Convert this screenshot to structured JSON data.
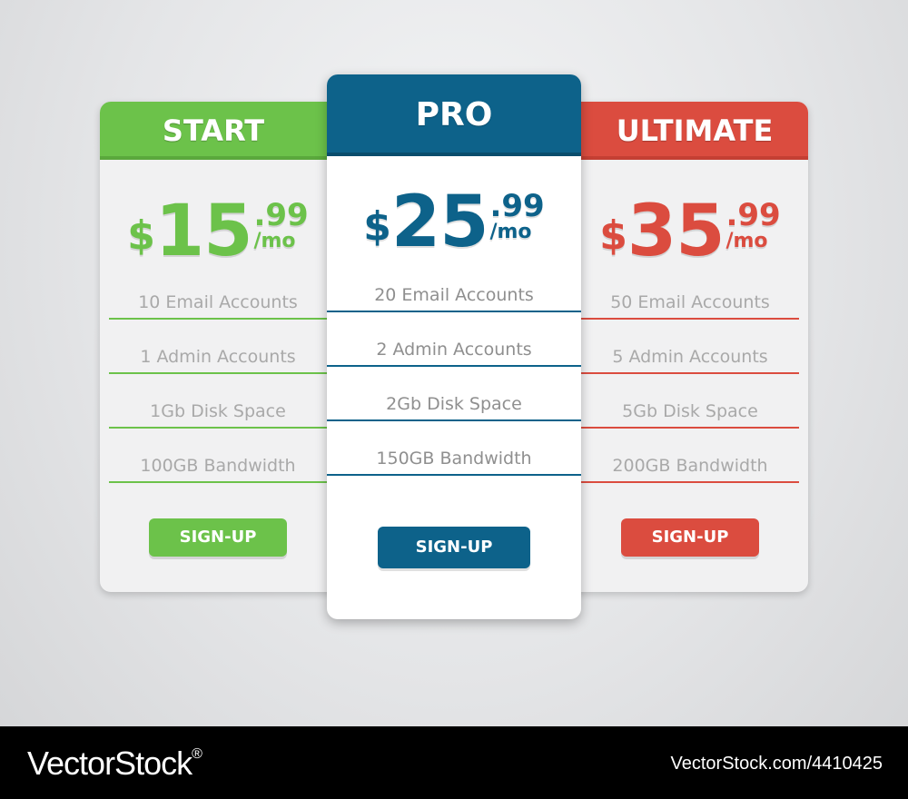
{
  "plans": [
    {
      "name": "START",
      "currency": "$",
      "amount": "15",
      "cents": ".99",
      "period": "/mo",
      "features": [
        "10 Email Accounts",
        "1 Admin Accounts",
        "1Gb Disk Space",
        "100GB Bandwidth"
      ],
      "button_label": "SIGN-UP",
      "color": "#6cc24a"
    },
    {
      "name": "PRO",
      "currency": "$",
      "amount": "25",
      "cents": ".99",
      "period": "/mo",
      "features": [
        "20 Email Accounts",
        "2 Admin Accounts",
        "2Gb Disk Space",
        "150GB Bandwidth"
      ],
      "button_label": "SIGN-UP",
      "color": "#0d628a"
    },
    {
      "name": "ULTIMATE",
      "currency": "$",
      "amount": "35",
      "cents": ".99",
      "period": "/mo",
      "features": [
        "50 Email Accounts",
        "5 Admin Accounts",
        "5Gb Disk Space",
        "200GB Bandwidth"
      ],
      "button_label": "SIGN-UP",
      "color": "#db4c3f"
    }
  ],
  "footer": {
    "brand": "VectorStock",
    "brand_mark": "®",
    "stock_id": "VectorStock.com/4410425"
  }
}
